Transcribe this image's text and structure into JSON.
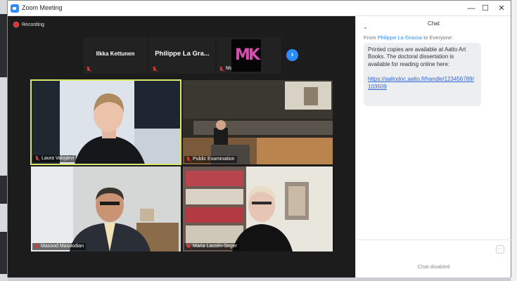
{
  "window": {
    "title": "Zoom Meeting",
    "controls": {
      "minimize": "—",
      "maximize": "☐",
      "close": "✕"
    }
  },
  "meeting": {
    "recording_label": "Recording",
    "strip": [
      {
        "name": "Ilkka Kettunen",
        "muted": true
      },
      {
        "name": "Philippe La Gra...",
        "muted": true
      },
      {
        "name": "Matti Korpi",
        "muted": true,
        "logo_text": "MK"
      }
    ],
    "next_page_icon": "chevron-right-icon",
    "tiles": [
      {
        "name": "Laura Valojärvi",
        "active_speaker": true
      },
      {
        "name": "Public Examination"
      },
      {
        "name": "Masood Masoodian"
      },
      {
        "name": "Maria Lassén-Seger"
      }
    ]
  },
  "chat": {
    "title": "Chat",
    "from_prefix": "From",
    "sender": "Philippe La Grassa",
    "to_text": "to Everyone:",
    "message_text": "Printed copies are available at Aalto Art Books.  The doctoral dissertation is available for reading online here:",
    "message_link": "https://aaltodoc.aalto.fi/handle/123456789/103509",
    "more_label": "···",
    "disabled_text": "Chat disabled"
  },
  "colors": {
    "accent": "#2d8cff",
    "active_speaker_border": "#d9e86a",
    "recording": "#e02828"
  }
}
